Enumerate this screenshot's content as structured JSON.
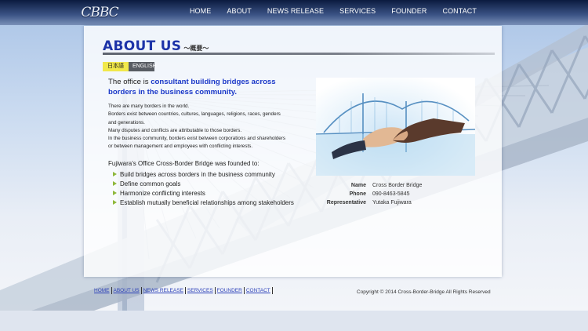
{
  "brand": {
    "logo_text": "CBBC"
  },
  "nav": {
    "items": [
      "HOME",
      "ABOUT",
      "NEWS RELEASE",
      "SERVICES",
      "FOUNDER",
      "CONTACT"
    ]
  },
  "page": {
    "title": "ABOUT US",
    "title_suffix": "～概要～",
    "languages": [
      "日本語",
      "ENGLISH"
    ]
  },
  "lead": {
    "prefix": "The office is ",
    "highlight": "consultant building bridges across borders in the business community."
  },
  "body": [
    "There are many borders in the world.",
    "Borders exist between countries, cultures, languages, religions, races, genders",
    "and generations.",
    "Many disputes and conflicts are attributable to those borders.",
    "In the business community, borders exist between corporations and shareholders",
    "or between management and employees with conflicting interests."
  ],
  "founded_intro": "Fujiwara's Office Cross-Border Bridge was founded to:",
  "goals": [
    "Build bridges across borders in the business community",
    "Define common goals",
    "Harmonize conflicting interests",
    "Establish mutually beneficial relationships among stakeholders"
  ],
  "info": [
    {
      "label": "Name",
      "value": "Cross Border Bridge"
    },
    {
      "label": "Phone",
      "value": "090-8463-5845"
    },
    {
      "label": "Representative",
      "value": "Yutaka Fujiwara"
    }
  ],
  "footer": {
    "links": [
      "HOME",
      "ABOUT US",
      "NEWS RELEASE",
      "SERVICES",
      "FOUNDER",
      "CONTACT"
    ],
    "copyright": "Copyright © 2014 Cross-Border-Bridge All Rights Reserved"
  },
  "colors": {
    "heading": "#1d33a8",
    "highlight": "#1c39c8",
    "lang_jp": "#f1e84a",
    "lang_en": "#585c63",
    "bullet": "#8fb83c",
    "nav_bg": "#0b1b3f"
  }
}
